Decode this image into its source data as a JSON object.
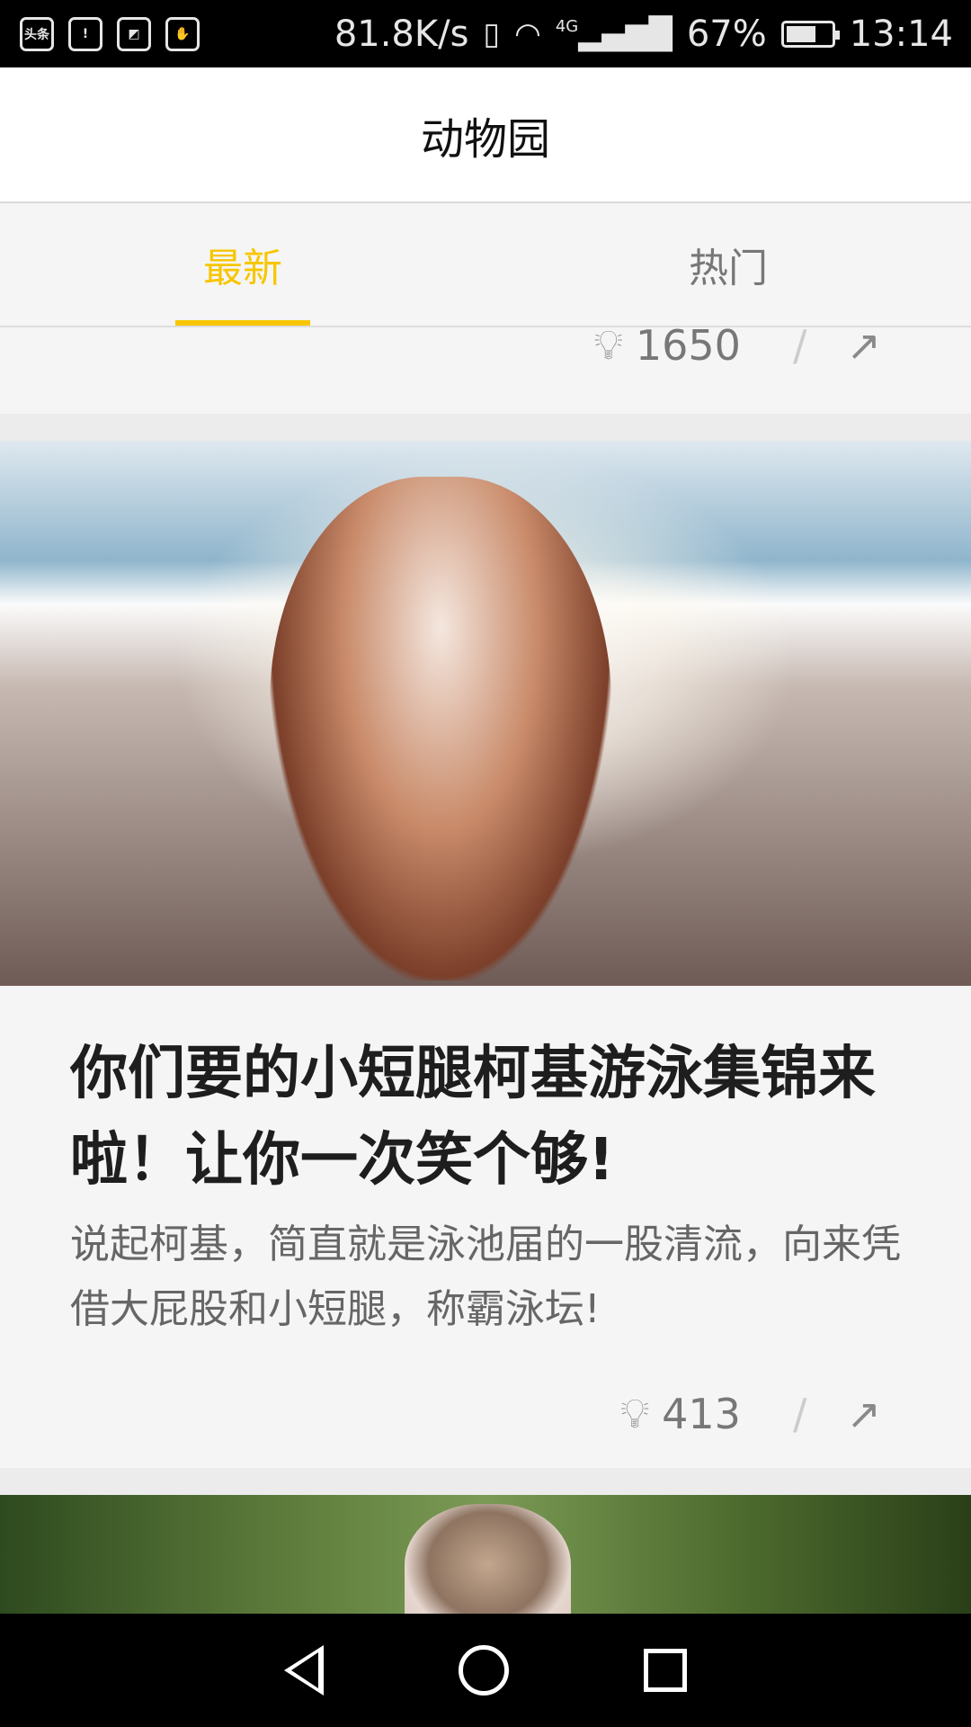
{
  "status_bar": {
    "left_icons": [
      "toutiao-icon",
      "battery-alert-icon",
      "image-icon",
      "hand-icon"
    ],
    "left_icon_text": "头条",
    "speed": "81.8K/s",
    "network": "4G",
    "battery_pct": "67%",
    "battery_level": 0.67,
    "time": "13:14"
  },
  "header": {
    "title": "动物园"
  },
  "tabs": [
    {
      "label": "最新",
      "active": true
    },
    {
      "label": "热门",
      "active": false
    }
  ],
  "colors": {
    "accent": "#f7c600",
    "text_title": "#1e1e1e",
    "text_desc": "#666666",
    "meta": "#777777"
  },
  "feed": {
    "prev_card": {
      "likes": "1650"
    },
    "card": {
      "image_alt": "dog on beach",
      "title": "你们要的小短腿柯基游泳集锦来啦！让你一次笑个够!",
      "description": "说起柯基，简直就是泳池届的一股清流，向来凭借大屁股和小短腿，称霸泳坛!",
      "likes": "413"
    },
    "next_card": {
      "image_alt": "pug in blanket"
    }
  },
  "nav": {
    "back": "back-icon",
    "home": "home-icon",
    "recents": "recents-icon"
  }
}
